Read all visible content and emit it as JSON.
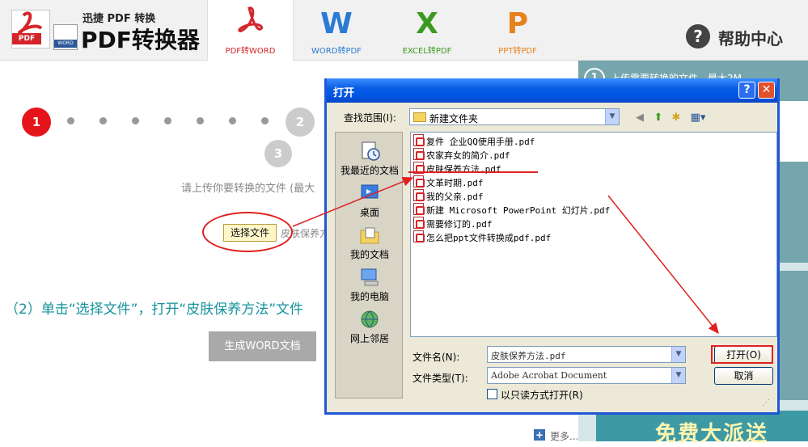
{
  "header": {
    "logo_sub": "迅捷 PDF 转换",
    "logo_main": "PDF转换器",
    "logo_pdf_tag": "PDF",
    "logo_word_tag": "WORD",
    "tabs": [
      {
        "glyph": "",
        "label": "PDF转WORD"
      },
      {
        "glyph": "W",
        "label": "WORD转PDF"
      },
      {
        "glyph": "X",
        "label": "EXCEL转PDF"
      },
      {
        "glyph": "P",
        "label": "PPT转PDF"
      }
    ],
    "help_label": "帮助中心",
    "help_glyph": "?"
  },
  "steps": [
    "1",
    "2",
    "3"
  ],
  "main": {
    "upload_hint": "请上传你要转换的文件 (最大",
    "choose_button": "选择文件",
    "chosen_file": "皮肤保养方",
    "instruction": "（2）单击“选择文件”，打开“皮肤保养方法”文件",
    "generate_button": "生成WORD文档"
  },
  "right_panel": {
    "top_number": "1",
    "top_text": "上传需要转换的文件，最大2M",
    "banner_text": "免费大派送",
    "more_label": "更多..."
  },
  "dialog": {
    "title": "打开",
    "help_btn": "?",
    "close_btn": "✕",
    "lookin_label": "查找范围(I):",
    "lookin_value": "新建文件夹",
    "places": [
      "我最近的文档",
      "桌面",
      "我的文档",
      "我的电脑",
      "网上邻居"
    ],
    "files": [
      "复件 企业QQ使用手册.pdf",
      "农家弃女的简介.pdf",
      "皮肤保养方法.pdf",
      "文革时期.pdf",
      "我的父亲.pdf",
      "新建 Microsoft PowerPoint 幻灯片.pdf",
      "需要修订的.pdf",
      "怎么把ppt文件转换成pdf.pdf"
    ],
    "filename_label": "文件名(N):",
    "filename_value": "皮肤保养方法.pdf",
    "filetype_label": "文件类型(T):",
    "filetype_value": "Adobe Acrobat Document",
    "readonly_label": "以只读方式打开(R)",
    "open_button": "打开(O)",
    "cancel_button": "取消"
  },
  "colors": {
    "accent_red": "#e5141b",
    "xp_title_blue": "#0055e5",
    "instruction_teal": "#16929b"
  }
}
